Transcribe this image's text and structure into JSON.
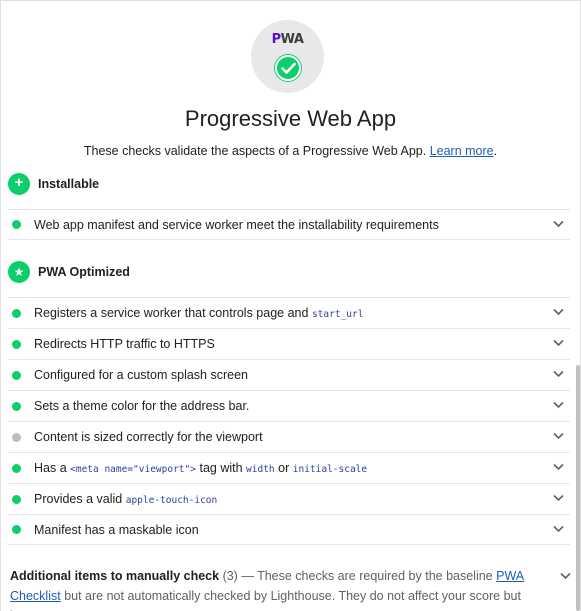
{
  "header": {
    "logo_text_p": "P",
    "logo_text_rest": "WA",
    "title": "Progressive Web App",
    "description": "These checks validate the aspects of a Progressive Web App.",
    "learn_more": "Learn more",
    "description_end": "."
  },
  "groups": {
    "installable": {
      "label": "Installable",
      "icon": "plus-icon"
    },
    "optimized": {
      "label": "PWA Optimized",
      "icon": "star-icon"
    }
  },
  "audits": {
    "installability": {
      "text": "Web app manifest and service worker meet the installability requirements",
      "status": "pass"
    },
    "service_worker": {
      "text": "Registers a service worker that controls page and",
      "code": "start_url",
      "status": "pass"
    },
    "redirects": {
      "text": "Redirects HTTP traffic to HTTPS",
      "status": "pass"
    },
    "splash": {
      "text": "Configured for a custom splash screen",
      "status": "pass"
    },
    "theme": {
      "text": "Sets a theme color for the address bar.",
      "status": "pass"
    },
    "content_width": {
      "text": "Content is sized correctly for the viewport",
      "status": "neutral"
    },
    "viewport": {
      "prefix": "Has a",
      "code1": "<meta name=\"viewport\">",
      "mid": "tag with",
      "code2": "width",
      "or": "or",
      "code3": "initial-scale",
      "status": "pass"
    },
    "apple_icon": {
      "text": "Provides a valid",
      "code": "apple-touch-icon",
      "status": "pass"
    },
    "maskable": {
      "text": "Manifest has a maskable icon",
      "status": "pass"
    }
  },
  "manual": {
    "title": "Additional items to manually check",
    "count": "(3)",
    "dash": "—",
    "body": "These checks are required by the baseline",
    "link": "PWA Checklist",
    "body2": "but are not automatically checked by Lighthouse. They do not affect your score but it's"
  },
  "colors": {
    "pass": "#0cce6b",
    "neutral": "#bdbdbd",
    "link": "#1a5fb4",
    "code": "#303f9f"
  }
}
